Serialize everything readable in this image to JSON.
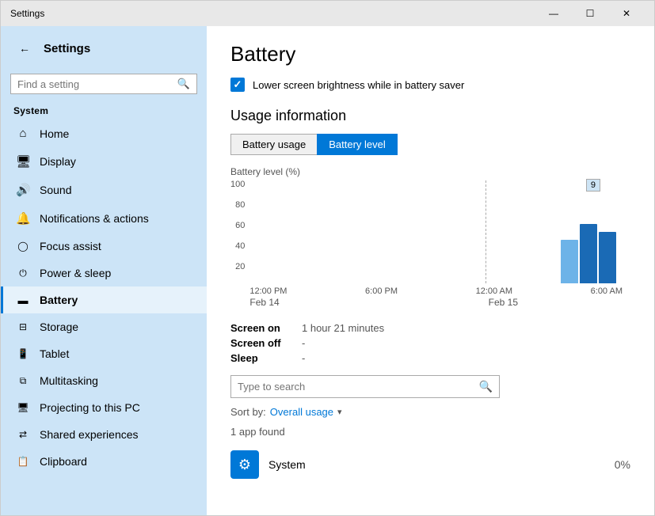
{
  "window": {
    "title": "Settings",
    "controls": {
      "minimize": "—",
      "maximize": "☐",
      "close": "✕"
    }
  },
  "sidebar": {
    "back_icon": "←",
    "title": "Settings",
    "search_placeholder": "Find a setting",
    "search_icon": "🔍",
    "section_label": "System",
    "items": [
      {
        "id": "home",
        "label": "Home",
        "icon": "⌂"
      },
      {
        "id": "display",
        "label": "Display",
        "icon": "🖥"
      },
      {
        "id": "sound",
        "label": "Sound",
        "icon": "🔊"
      },
      {
        "id": "notifications",
        "label": "Notifications & actions",
        "icon": "🔔"
      },
      {
        "id": "focus",
        "label": "Focus assist",
        "icon": "⏻"
      },
      {
        "id": "power",
        "label": "Power & sleep",
        "icon": "⏻"
      },
      {
        "id": "battery",
        "label": "Battery",
        "icon": "🔋",
        "active": true
      },
      {
        "id": "storage",
        "label": "Storage",
        "icon": "💾"
      },
      {
        "id": "tablet",
        "label": "Tablet",
        "icon": "📱"
      },
      {
        "id": "multitasking",
        "label": "Multitasking",
        "icon": "⧉"
      },
      {
        "id": "projecting",
        "label": "Projecting to this PC",
        "icon": "📺"
      },
      {
        "id": "shared",
        "label": "Shared experiences",
        "icon": "⇄"
      },
      {
        "id": "clipboard",
        "label": "Clipboard",
        "icon": "📋"
      }
    ]
  },
  "main": {
    "page_title": "Battery",
    "checkbox_label": "Lower screen brightness while in battery saver",
    "section_heading": "Usage information",
    "tabs": [
      {
        "id": "usage",
        "label": "Battery usage"
      },
      {
        "id": "level",
        "label": "Battery level",
        "active": true
      }
    ],
    "chart": {
      "y_label": "Battery level (%)",
      "y_axis": [
        "100",
        "80",
        "60",
        "40",
        "20"
      ],
      "x_labels": [
        "12:00 PM",
        "6:00 PM",
        "12:00 AM",
        "6:00 AM"
      ],
      "date_labels": [
        "Feb 14",
        "",
        "Feb 15",
        ""
      ],
      "callout": "9"
    },
    "info": {
      "screen_on_label": "Screen on",
      "screen_on_value": "1 hour 21 minutes",
      "screen_off_label": "Screen off",
      "screen_off_value": "-",
      "sleep_label": "Sleep",
      "sleep_value": "-"
    },
    "search_placeholder": "Type to search",
    "sort_by_label": "Sort by:",
    "sort_by_value": "Overall usage",
    "found_count": "1 app found",
    "app": {
      "name": "System",
      "icon": "⚙",
      "usage": "0%"
    }
  }
}
